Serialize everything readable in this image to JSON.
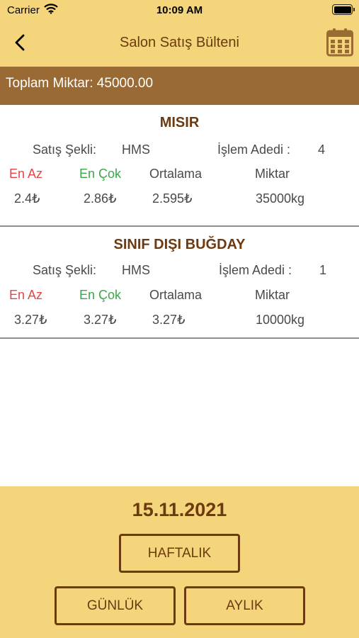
{
  "status_bar": {
    "carrier": "Carrier",
    "time": "10:09 AM"
  },
  "nav": {
    "title": "Salon Satış Bülteni"
  },
  "summary": {
    "total_label": "Toplam Miktar: 45000.00"
  },
  "labels": {
    "sales_type": "Satış Şekli:",
    "transaction_count": "İşlem Adedi :",
    "min": "En Az",
    "max": "En Çok",
    "avg": "Ortalama",
    "amount": "Miktar"
  },
  "items": [
    {
      "name": "MISIR",
      "sales_type": "HMS",
      "transaction_count": "4",
      "min": "2.4₺",
      "max": "2.86₺",
      "avg": "2.595₺",
      "amount": "35000kg"
    },
    {
      "name": "SINIF DIŞI BUĞDAY",
      "sales_type": "HMS",
      "transaction_count": "1",
      "min": "3.27₺",
      "max": "3.27₺",
      "avg": "3.27₺",
      "amount": "10000kg"
    }
  ],
  "footer": {
    "date": "15.11.2021",
    "weekly_label": "HAFTALIK",
    "daily_label": "GÜNLÜK",
    "monthly_label": "AYLIK"
  },
  "colors": {
    "bar": "#f4d57b",
    "brown": "#6b3a10",
    "band": "#9a6a34",
    "min": "#e64545",
    "max": "#3aa84a"
  }
}
